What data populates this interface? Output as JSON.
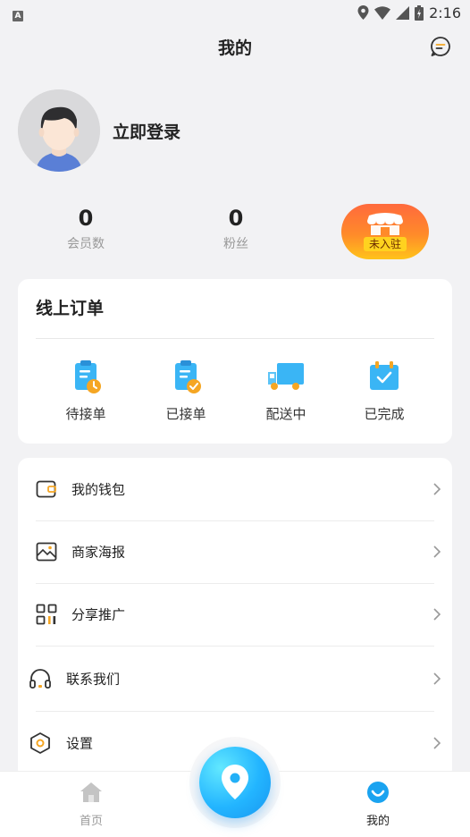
{
  "status_bar": {
    "left_icon_letter": "A",
    "time": "2:16"
  },
  "header": {
    "title": "我的",
    "message_icon": "chat-bubble-icon"
  },
  "profile": {
    "login_text": "立即登录",
    "avatar_icon": "default-avatar-icon"
  },
  "stats": [
    {
      "value": "0",
      "label": "会员数"
    },
    {
      "value": "0",
      "label": "粉丝"
    }
  ],
  "shop_badge": {
    "label": "未入驻",
    "icon": "shop-icon"
  },
  "orders": {
    "title": "线上订单",
    "items": [
      {
        "label": "待接单",
        "icon": "clipboard-clock-icon"
      },
      {
        "label": "已接单",
        "icon": "clipboard-check-icon"
      },
      {
        "label": "配送中",
        "icon": "delivery-truck-icon"
      },
      {
        "label": "已完成",
        "icon": "calendar-check-icon"
      }
    ]
  },
  "menu": {
    "items": [
      {
        "label": "我的钱包",
        "icon": "wallet-icon"
      },
      {
        "label": "商家海报",
        "icon": "image-poster-icon"
      },
      {
        "label": "分享推广",
        "icon": "qr-code-icon"
      },
      {
        "label": "联系我们",
        "icon": "headset-icon"
      },
      {
        "label": "设置",
        "icon": "settings-hex-icon"
      }
    ]
  },
  "bottom_nav": {
    "home_label": "首页",
    "mine_label": "我的",
    "center_icon": "location-pin-icon",
    "active_color": "#1aa3f0",
    "inactive_color": "#999999"
  },
  "colors": {
    "accent_blue": "#2fa7ec",
    "order_icon_blue": "#3ab5f5",
    "order_icon_orange": "#f5a623",
    "shop_gradient_top": "#ff6a3d",
    "shop_gradient_bottom": "#ffc31a"
  }
}
